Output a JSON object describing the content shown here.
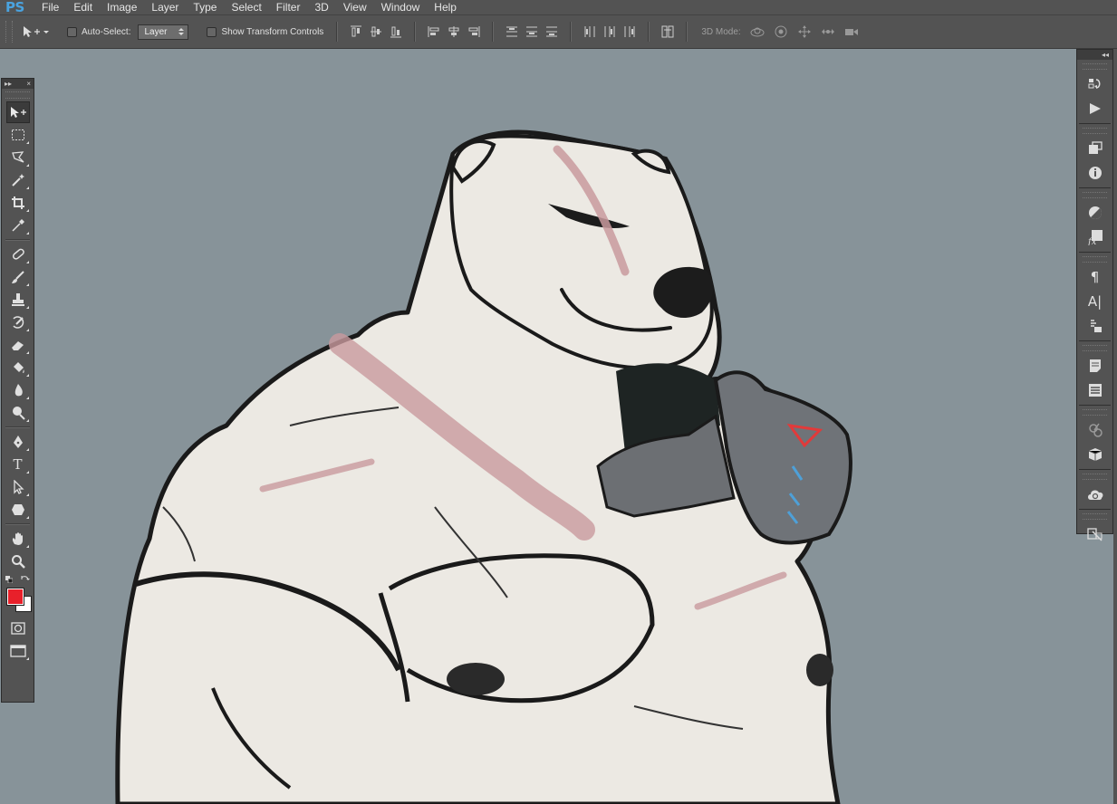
{
  "app": {
    "logo": "PS"
  },
  "menu": [
    "File",
    "Edit",
    "Image",
    "Layer",
    "Type",
    "Select",
    "Filter",
    "3D",
    "View",
    "Window",
    "Help"
  ],
  "options": {
    "auto_select_label": "Auto-Select:",
    "auto_select_checked": false,
    "target_value": "Layer",
    "show_transform_label": "Show Transform Controls",
    "show_transform_checked": false,
    "mode3d_label": "3D Mode:"
  },
  "toolpanel": {
    "expand": "▸▸",
    "close": "×",
    "tools": [
      "move-tool",
      "rectangular-marquee-tool",
      "polygonal-lasso-tool",
      "magic-wand-tool",
      "crop-tool",
      "eyedropper-tool",
      "spot-healing-brush-tool",
      "brush-tool",
      "clone-stamp-tool",
      "history-brush-tool",
      "eraser-tool",
      "paint-bucket-tool",
      "blur-tool",
      "dodge-tool",
      "pen-tool",
      "type-tool",
      "path-selection-tool",
      "shape-tool",
      "hand-tool",
      "zoom-tool"
    ],
    "type_tool_glyph": "T",
    "foreground_color": "#e8202a",
    "background_color": "#ffffff"
  },
  "rightdock": {
    "collapse": "◂◂",
    "paragraph_glyph": "¶",
    "character_glyph": "A|",
    "fx_glyph": "fx"
  }
}
